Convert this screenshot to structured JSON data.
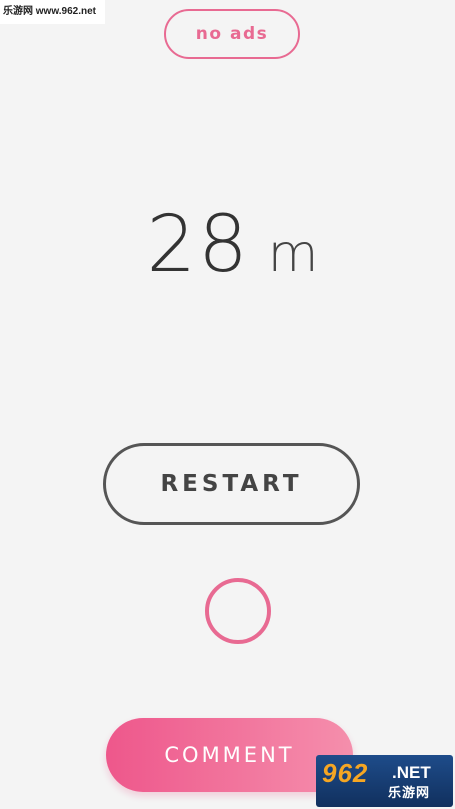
{
  "watermark": {
    "top_text": "乐游网 www.962.net",
    "logo_main": "962",
    "logo_net": ".NET",
    "logo_sub": "乐游网"
  },
  "header": {
    "no_ads_label": "no ads"
  },
  "score": {
    "value": "28",
    "unit": "m"
  },
  "actions": {
    "restart_label": "RESTART",
    "comment_label": "COMMENT"
  },
  "colors": {
    "accent_pink": "#e86a92",
    "button_gradient_start": "#ee4f86",
    "button_gradient_end": "#f58aa9",
    "outline_gray": "#555555",
    "background": "#f4f4f4"
  },
  "icons": {
    "center_icon": "circle-outline-icon"
  }
}
